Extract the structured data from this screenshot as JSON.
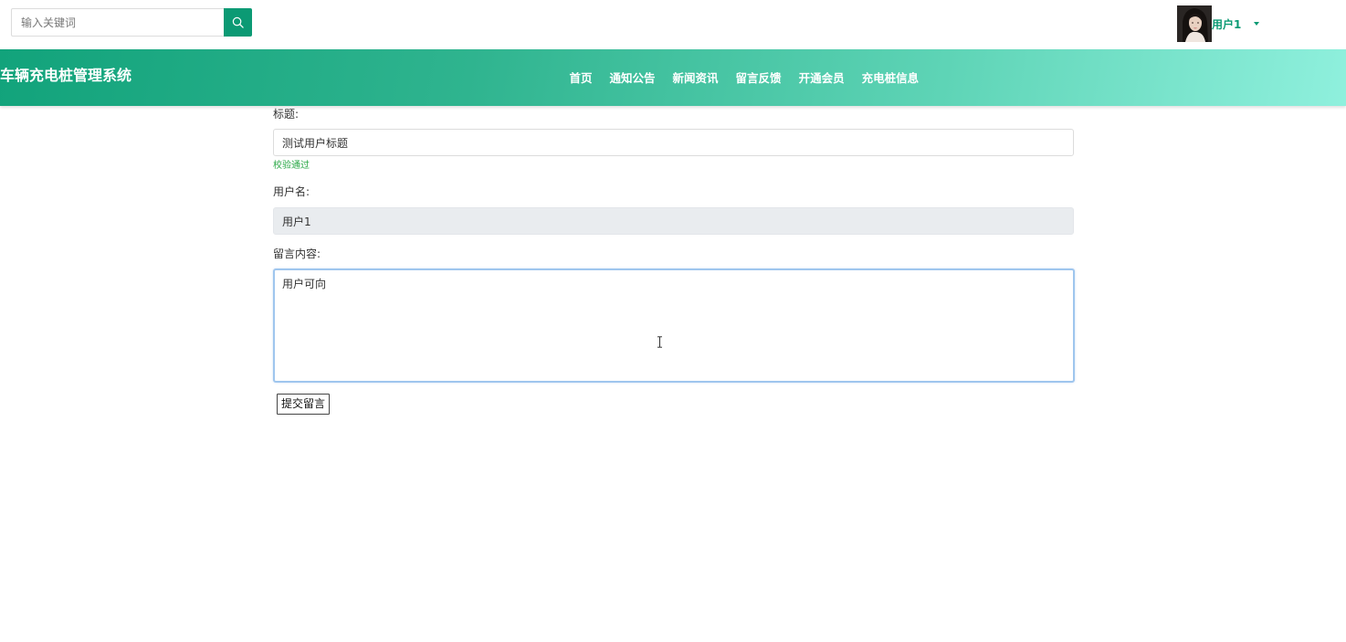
{
  "search": {
    "placeholder": "输入关键词"
  },
  "user": {
    "name": "用户1"
  },
  "header": {
    "title": "车辆充电桩管理系统"
  },
  "nav": [
    {
      "label": "首页"
    },
    {
      "label": "通知公告"
    },
    {
      "label": "新闻资讯"
    },
    {
      "label": "留言反馈"
    },
    {
      "label": "开通会员"
    },
    {
      "label": "充电桩信息"
    }
  ],
  "form": {
    "title_label": "标题:",
    "title_value": "测试用户标题",
    "title_hint": "校验通过",
    "username_label": "用户名:",
    "username_value": "用户1",
    "content_label": "留言内容:",
    "content_value": "用户可向",
    "submit_label": "提交留言"
  },
  "colors": {
    "accent": "#0b9a74",
    "header_start": "#12a37b",
    "header_end": "#8ff0dd",
    "hint": "#28a745"
  },
  "icons": {
    "search": "search-icon",
    "caret": "caret-down-icon",
    "cursor": "text-cursor-icon"
  }
}
